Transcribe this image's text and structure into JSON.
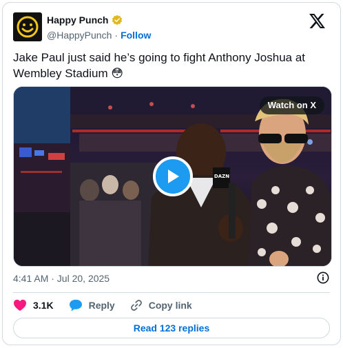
{
  "colors": {
    "accent": "#1d9bf0",
    "link": "#006fd6",
    "like": "#f91880",
    "muted": "#536471",
    "text": "#0f1419"
  },
  "author": {
    "display_name": "Happy Punch",
    "verified_icon": "verified-badge-icon",
    "handle": "@HappyPunch",
    "separator": "·",
    "follow_label": "Follow",
    "avatar_icon": "smiley-face-icon"
  },
  "tweet": {
    "text": "Jake Paul just said he’s going to fight Anthony Joshua at Wembley Stadium 😳"
  },
  "media": {
    "watch_label": "Watch on X",
    "play_icon": "play-icon",
    "mic_flag_text": "DAZN"
  },
  "meta": {
    "timestamp": "4:41 AM · Jul 20, 2025",
    "info_icon": "info-icon"
  },
  "actions": {
    "like_count": "3.1K",
    "reply_label": "Reply",
    "copy_label": "Copy link"
  },
  "footer": {
    "read_replies_label": "Read 123 replies"
  }
}
